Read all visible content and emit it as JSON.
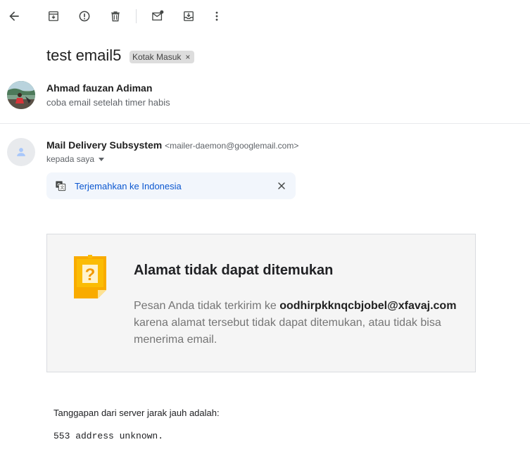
{
  "toolbar": {
    "back": "back-arrow-icon",
    "archive": "archive-icon",
    "report_spam": "report-spam-icon",
    "delete": "trash-icon",
    "mark_unread": "mark-unread-icon",
    "move_to": "move-to-icon",
    "more": "more-vert-icon"
  },
  "subject": "test email5",
  "label": "Kotak Masuk",
  "label_remove": "×",
  "thread": [
    {
      "sender": "Ahmad fauzan Adiman",
      "snippet": "coba email setelah timer habis"
    },
    {
      "sender": "Mail Delivery Subsystem",
      "sender_email": "<mailer-daemon@googlemail.com>",
      "to": "kepada saya"
    }
  ],
  "translate": {
    "link": "Terjemahkan ke Indonesia",
    "icon": "translate-icon",
    "close_icon": "close-icon"
  },
  "bounce": {
    "title": "Alamat tidak dapat ditemukan",
    "body_prefix": "Pesan Anda tidak terkirim ke ",
    "address": "oodhirpkknqcbjobel@xfavaj.com",
    "body_suffix": " karena alamat tersebut tidak dapat ditemukan, atau tidak bisa menerima email.",
    "icon_color": "#f9ab00"
  },
  "remote": {
    "label": "Tanggapan dari server jarak jauh adalah:",
    "code": "553 address unknown."
  },
  "colors": {
    "link": "#0b57d0",
    "chip_bg": "#dddddd",
    "translate_bg": "#f2f6fc",
    "bounce_bg": "#f5f5f5"
  }
}
